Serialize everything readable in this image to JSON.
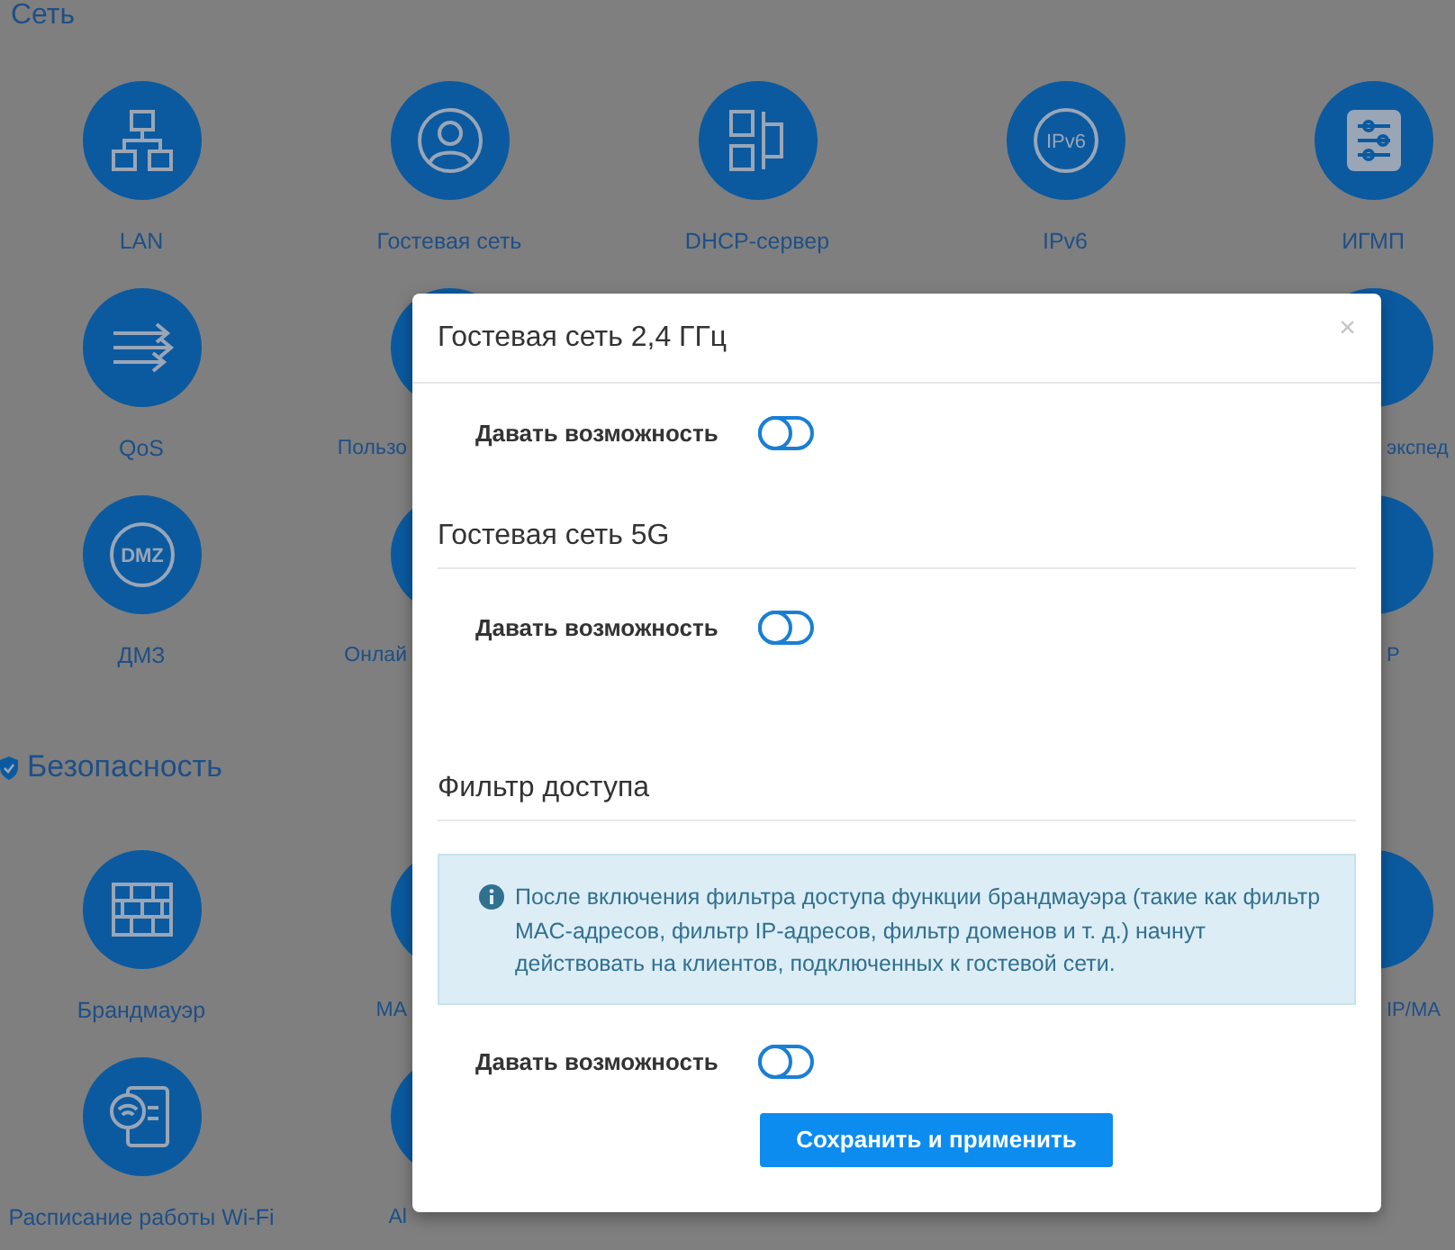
{
  "sections": [
    {
      "title": "Сеть",
      "rows": [
        {
          "items": [
            {
              "kind": "lan",
              "label": "LAN"
            },
            {
              "kind": "user",
              "label": "Гостевая сеть"
            },
            {
              "kind": "dhcp",
              "label": "DHCP-сервер"
            },
            {
              "kind": "ipv6",
              "label": "IPv6",
              "icon_text": "IPv6"
            },
            {
              "kind": "igmp",
              "label": "ИГМП"
            }
          ]
        },
        {
          "items": [
            {
              "kind": "qos",
              "label": "QoS"
            },
            {
              "kind": "plain",
              "label": "Пользо"
            },
            {
              "kind": "covered"
            },
            {
              "kind": "covered"
            },
            {
              "kind": "plain",
              "label": "экспед"
            }
          ]
        },
        {
          "items": [
            {
              "kind": "dmz",
              "label": "ДМЗ",
              "icon_text": "DMZ"
            },
            {
              "kind": "plain",
              "label": "Онлай"
            },
            {
              "kind": "covered"
            },
            {
              "kind": "covered"
            },
            {
              "kind": "plain",
              "label": "P"
            }
          ]
        }
      ]
    },
    {
      "title": "Безопасность",
      "rows": [
        {
          "items": [
            {
              "kind": "firewall",
              "label": "Брандмауэр"
            },
            {
              "kind": "plain",
              "label": "МА"
            },
            {
              "kind": "covered"
            },
            {
              "kind": "covered"
            },
            {
              "kind": "plain",
              "label": "IP/MA"
            }
          ]
        },
        {
          "items": [
            {
              "kind": "schedule",
              "label": "Расписание работы Wi-Fi"
            },
            {
              "kind": "plain",
              "label": "Al"
            },
            {
              "kind": "covered"
            },
            {
              "kind": "covered"
            },
            {
              "kind": "covered"
            }
          ]
        }
      ]
    }
  ],
  "dialog": {
    "title": "Гостевая сеть 2,4 ГГц",
    "close": "×",
    "blocks": [
      {
        "kind": "toggle",
        "label": "Давать возможность",
        "on": false
      },
      {
        "kind": "heading",
        "text": "Гостевая сеть 5G"
      },
      {
        "kind": "toggle",
        "label": "Давать возможность",
        "on": false
      },
      {
        "kind": "heading",
        "text": "Фильтр доступа"
      },
      {
        "kind": "info",
        "text": "После включения фильтра доступа функции брандмауэра (такие как фильтр MAC-адресов, фильтр IP-адресов, фильтр доменов и т. д.) начнут действовать на клиентов, подключенных к гостевой сети."
      },
      {
        "kind": "toggle",
        "label": "Давать возможность",
        "on": false
      },
      {
        "kind": "button",
        "label": "Сохранить и применить"
      }
    ]
  }
}
